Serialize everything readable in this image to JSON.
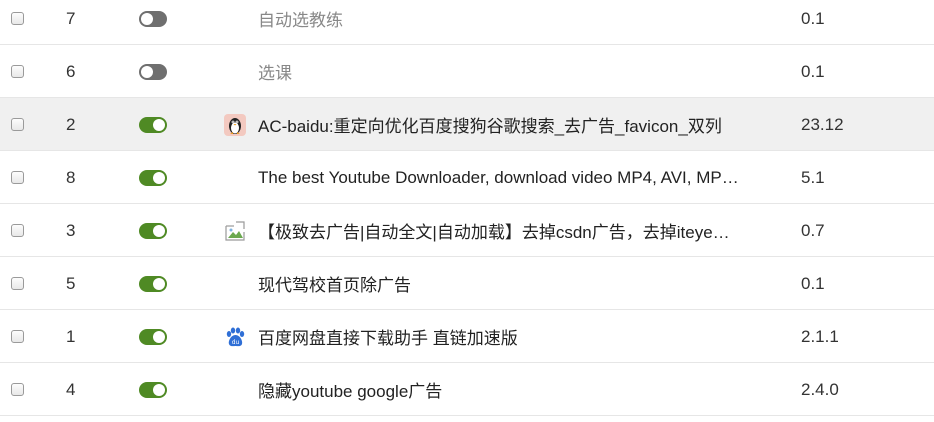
{
  "rows": [
    {
      "order": "7",
      "enabled": false,
      "icon": "",
      "name": "自动选教练",
      "version": "0.1"
    },
    {
      "order": "6",
      "enabled": false,
      "icon": "",
      "name": "选课",
      "version": "0.1"
    },
    {
      "order": "2",
      "enabled": true,
      "icon": "penguin-icon",
      "name": "AC-baidu:重定向优化百度搜狗谷歌搜索_去广告_favicon_双列",
      "version": "23.12"
    },
    {
      "order": "8",
      "enabled": true,
      "icon": "",
      "name": "The best Youtube Downloader, download video MP4, AVI, MP…",
      "version": "5.1"
    },
    {
      "order": "3",
      "enabled": true,
      "icon": "broken-image-icon",
      "name": "【极致去广告|自动全文|自动加载】去掉csdn广告，去掉iteye…",
      "version": "0.7"
    },
    {
      "order": "5",
      "enabled": true,
      "icon": "",
      "name": "现代驾校首页除广告",
      "version": "0.1"
    },
    {
      "order": "1",
      "enabled": true,
      "icon": "baidu-paw-icon",
      "name": "百度网盘直接下载助手 直链加速版",
      "version": "2.1.1"
    },
    {
      "order": "4",
      "enabled": true,
      "icon": "",
      "name": "隐藏youtube google广告",
      "version": "2.4.0"
    }
  ],
  "colors": {
    "toggle_on": "#4f8a24",
    "toggle_off": "#6f6f6f",
    "row_hover": "#f0f0f0",
    "disabled_text": "#888888"
  }
}
